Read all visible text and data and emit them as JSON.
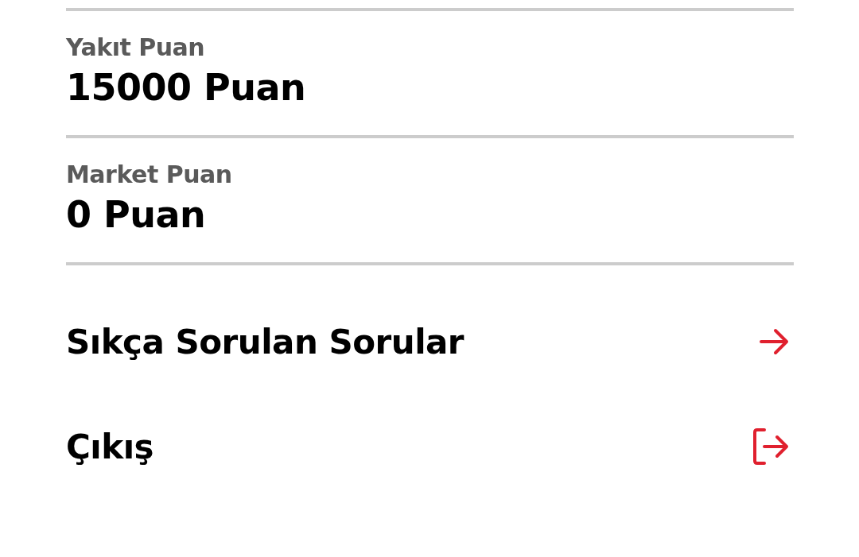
{
  "points": [
    {
      "label": "Yakıt Puan",
      "value": "15000 Puan"
    },
    {
      "label": "Market Puan",
      "value": "0 Puan"
    }
  ],
  "menu": [
    {
      "label": "Sıkça Sorulan Sorular",
      "kind": "arrow"
    },
    {
      "label": "Çıkış",
      "kind": "logout"
    }
  ]
}
